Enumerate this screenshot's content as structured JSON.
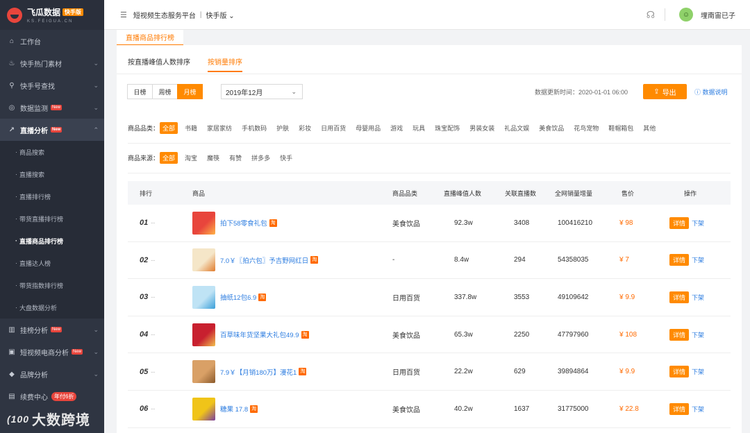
{
  "logo": {
    "title": "飞瓜数据",
    "badge": "快手版",
    "domain": "KS.FEIGUA.CN"
  },
  "sidebar": {
    "items": [
      {
        "label": "工作台",
        "icon": "home-icon"
      },
      {
        "label": "快手热门素材",
        "icon": "fire-icon"
      },
      {
        "label": "快手号查找",
        "icon": "search-icon"
      },
      {
        "label": "数据监测",
        "icon": "monitor-icon",
        "badge": "New"
      },
      {
        "label": "直播分析",
        "icon": "analysis-icon",
        "badge": "New"
      }
    ],
    "sub_items": [
      "商品搜索",
      "直播搜索",
      "直播排行榜",
      "带货直播排行榜",
      "直播商品排行榜",
      "直播达人榜",
      "带货指数排行榜",
      "大盘数据分析"
    ],
    "lower_items": [
      {
        "label": "挂榜分析",
        "icon": "bar-chart-icon",
        "badge": "New"
      },
      {
        "label": "短视频电商分析",
        "icon": "cart-icon",
        "badge": "New"
      },
      {
        "label": "品牌分析",
        "icon": "diamond-icon"
      },
      {
        "label": "续费中心",
        "icon": "wallet-icon",
        "promo": "年付6折"
      }
    ],
    "watermark": "大数跨境"
  },
  "topbar": {
    "platform": "短视频生态服务平台",
    "version": "快手版",
    "username": "埋南宙已子"
  },
  "page_tab": "直播商品排行榜",
  "subtabs": [
    "按直播峰值人数排序",
    "按销量排序"
  ],
  "periods": [
    "日榜",
    "周榜",
    "月榜"
  ],
  "month": "2019年12月",
  "update_time": "数据更新时间：2020-01-01 06:00",
  "export_label": "导出",
  "data_doc": "数据说明",
  "category": {
    "label": "商品品类：",
    "options": [
      "全部",
      "书籍",
      "家居家纺",
      "手机数码",
      "护肤",
      "彩妆",
      "日用百货",
      "母婴用品",
      "游戏",
      "玩具",
      "珠宝配饰",
      "男装女装",
      "礼品文娱",
      "美食饮品",
      "花鸟宠物",
      "鞋帽箱包",
      "其他"
    ]
  },
  "source": {
    "label": "商品来源：",
    "options": [
      "全部",
      "淘宝",
      "魔筷",
      "有赞",
      "拼多多",
      "快手"
    ]
  },
  "table": {
    "headers": [
      "排行",
      "商品",
      "商品品类",
      "直播峰值人数",
      "关联直播数",
      "全网销量增量",
      "售价",
      "操作"
    ],
    "rows": [
      {
        "rank": "01",
        "name": "拍下58零食礼包",
        "category": "美食饮品",
        "peak": "92.3w",
        "lives": "3408",
        "sales": "100416210",
        "price": "¥ 98"
      },
      {
        "rank": "02",
        "name": "7.0￥〖拍六包〗予吉野网红日",
        "category": "-",
        "peak": "8.4w",
        "lives": "294",
        "sales": "54358035",
        "price": "¥ 7"
      },
      {
        "rank": "03",
        "name": "抽纸12包6.9",
        "category": "日用百货",
        "peak": "337.8w",
        "lives": "3553",
        "sales": "49109642",
        "price": "¥ 9.9"
      },
      {
        "rank": "04",
        "name": "百草味年货坚果大礼包49.9",
        "category": "美食饮品",
        "peak": "65.3w",
        "lives": "2250",
        "sales": "47797960",
        "price": "¥ 108"
      },
      {
        "rank": "05",
        "name": "7.9￥【月销180万】漫花1",
        "category": "日用百货",
        "peak": "22.2w",
        "lives": "629",
        "sales": "39894864",
        "price": "¥ 9.9"
      },
      {
        "rank": "06",
        "name": "糖果 17.8",
        "category": "美食饮品",
        "peak": "40.2w",
        "lives": "1637",
        "sales": "31775000",
        "price": "¥ 22.8"
      }
    ],
    "detail_label": "详情",
    "offshelf_label": "下架",
    "tb_tag": "淘"
  }
}
